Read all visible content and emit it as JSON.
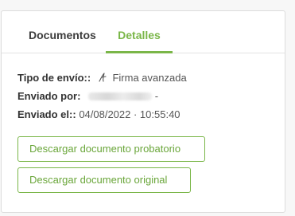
{
  "tabs": {
    "documents": "Documentos",
    "details": "Detalles"
  },
  "details": {
    "send_type_label": "Tipo de envío::",
    "send_type_value": "Firma avanzada",
    "sent_by_label": "Enviado por:",
    "sent_by_suffix": "-",
    "sent_at_label": "Enviado el::",
    "sent_at_value": "04/08/2022 · 10:55:40"
  },
  "buttons": {
    "download_proof": "Descargar documento probatorio",
    "download_original": "Descargar documento original"
  },
  "colors": {
    "accent": "#7ab648",
    "text": "#333333"
  },
  "icons": {
    "signature": "signature-icon"
  }
}
